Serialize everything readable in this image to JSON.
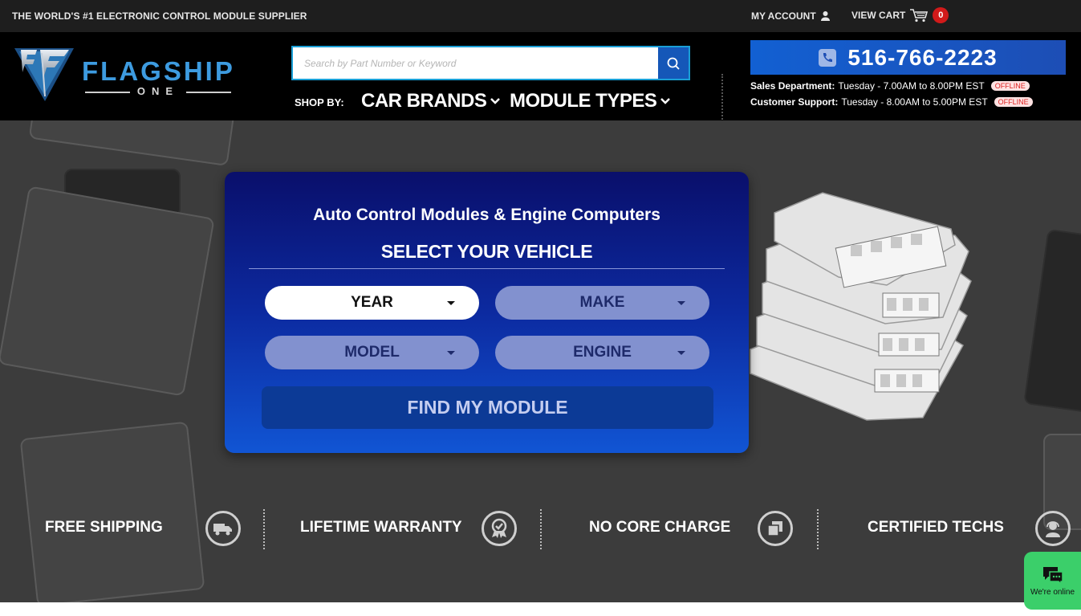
{
  "topbar": {
    "tagline": "THE WORLD'S #1 ELECTRONIC CONTROL MODULE SUPPLIER",
    "account_label": "MY ACCOUNT",
    "cart_label": "VIEW CART",
    "cart_count": "0"
  },
  "header": {
    "logo_word": "FLAGSHIP",
    "logo_sub": "ONE",
    "search_placeholder": "Search by Part Number or Keyword",
    "shop_by": "SHOP BY:",
    "nav": [
      {
        "label": "CAR BRANDS"
      },
      {
        "label": "MODULE TYPES"
      }
    ],
    "phone": "516-766-2223",
    "hours": [
      {
        "dept": "Sales Department:",
        "time": "Tuesday - 7.00AM to 8.00PM EST",
        "status": "OFFLINE"
      },
      {
        "dept": "Customer Support:",
        "time": "Tuesday - 8.00AM to 5.00PM EST",
        "status": "OFFLINE"
      }
    ]
  },
  "finder": {
    "title": "Auto Control Modules & Engine Computers",
    "subtitle": "SELECT YOUR VEHICLE",
    "selects": [
      {
        "label": "YEAR",
        "state": "active"
      },
      {
        "label": "MAKE",
        "state": "disabled"
      },
      {
        "label": "MODEL",
        "state": "disabled"
      },
      {
        "label": "ENGINE",
        "state": "disabled"
      }
    ],
    "button": "FIND MY MODULE"
  },
  "features": [
    {
      "label": "FREE SHIPPING",
      "icon": "truck-icon"
    },
    {
      "label": "LIFETIME WARRANTY",
      "icon": "award-icon"
    },
    {
      "label": "NO CORE CHARGE",
      "icon": "copy-icon"
    },
    {
      "label": "CERTIFIED TECHS",
      "icon": "technician-icon"
    }
  ],
  "chat": {
    "label": "We're online"
  },
  "colors": {
    "accent_blue": "#1557b8",
    "cart_badge": "#d11a1a",
    "chat_green": "#3bcf6a",
    "logo_blue": "#3d9be0"
  }
}
